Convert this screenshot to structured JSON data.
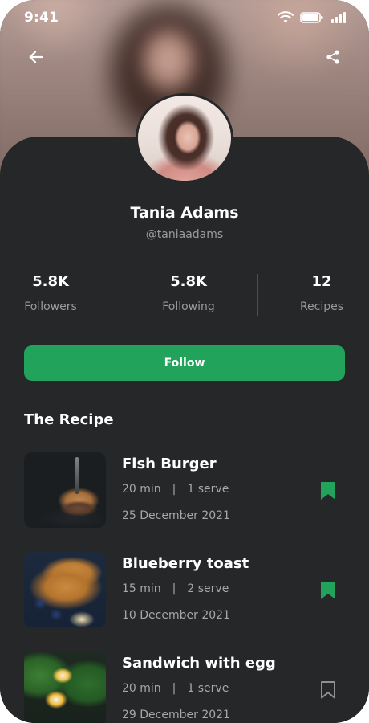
{
  "status_bar": {
    "time": "9:41"
  },
  "colors": {
    "accent": "#22a35c",
    "background": "#262728",
    "muted_text": "#9b9c9d"
  },
  "header": {
    "back_icon": "arrow-left-icon",
    "share_icon": "share-icon"
  },
  "profile": {
    "name": "Tania Adams",
    "handle": "@taniaadams",
    "stats": [
      {
        "value": "5.8K",
        "label": "Followers"
      },
      {
        "value": "5.8K",
        "label": "Following"
      },
      {
        "value": "12",
        "label": "Recipes"
      }
    ],
    "follow_label": "Follow"
  },
  "recipes_section": {
    "title": "The Recipe",
    "items": [
      {
        "title": "Fish Burger",
        "time": "20 min",
        "separator": "|",
        "serve": "1 serve",
        "date": "25 December 2021",
        "bookmarked": true
      },
      {
        "title": "Blueberry toast",
        "time": "15 min",
        "separator": "|",
        "serve": "2 serve",
        "date": "10 December 2021",
        "bookmarked": true
      },
      {
        "title": "Sandwich with egg",
        "time": "20 min",
        "separator": "|",
        "serve": "1 serve",
        "date": "29 December 2021",
        "bookmarked": false
      }
    ]
  }
}
